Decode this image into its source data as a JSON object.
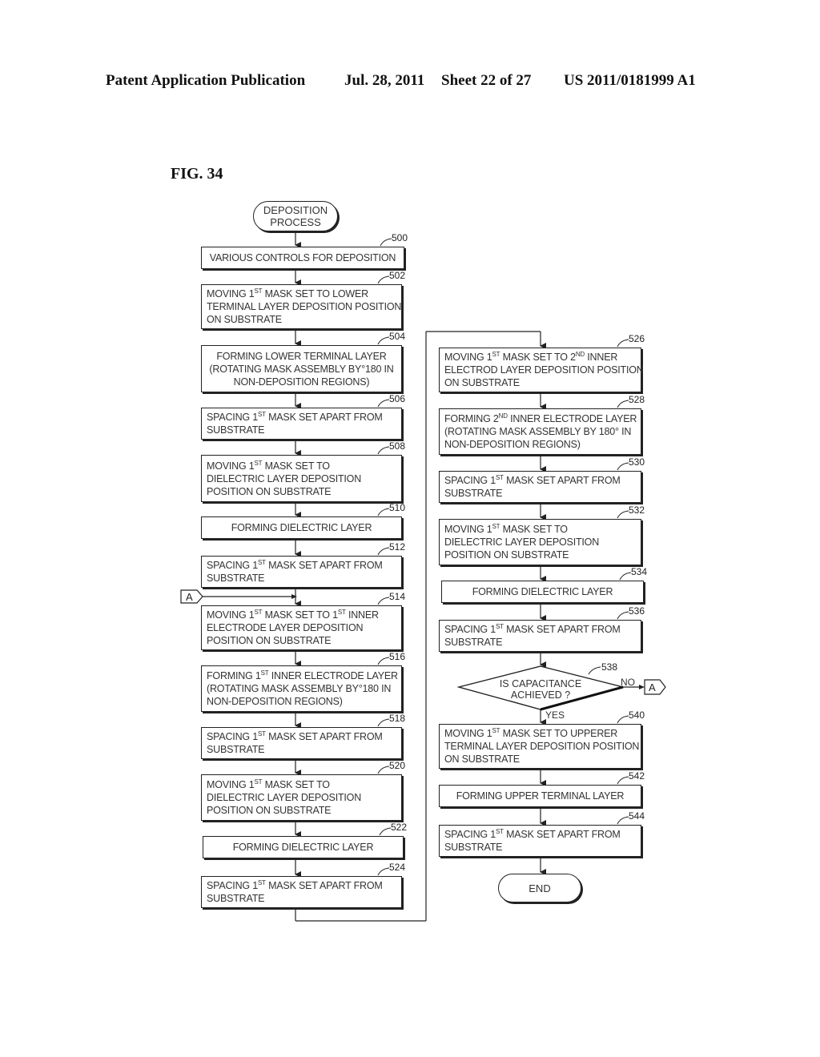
{
  "header": {
    "publication": "Patent Application Publication",
    "date": "Jul. 28, 2011",
    "sheet": "Sheet 22 of 27",
    "number": "US 2011/0181999 A1"
  },
  "figure": {
    "label": "FIG. 34",
    "start": {
      "line1": "DEPOSITION",
      "line2": "PROCESS"
    },
    "end": "END",
    "connector": "A",
    "decision": {
      "ref": "538",
      "line1": "IS CAPACITANCE",
      "line2": "ACHIEVED ?",
      "yes": "YES",
      "no": "NO"
    },
    "steps": [
      {
        "ref": "500",
        "lines": [
          "VARIOUS CONTROLS FOR DEPOSITION"
        ]
      },
      {
        "ref": "502",
        "lines": [
          "MOVING 1|ST| MASK SET TO LOWER",
          "TERMINAL LAYER DEPOSITION POSITION",
          "ON SUBSTRATE"
        ]
      },
      {
        "ref": "504",
        "lines": [
          "FORMING LOWER TERMINAL LAYER",
          "(ROTATING MASK ASSEMBLY BY°180  IN",
          "NON-DEPOSITION REGIONS)"
        ]
      },
      {
        "ref": "506",
        "lines": [
          "SPACING 1|ST| MASK SET APART FROM",
          "SUBSTRATE"
        ]
      },
      {
        "ref": "508",
        "lines": [
          "MOVING 1|ST| MASK SET TO",
          "DIELECTRIC LAYER DEPOSITION",
          "POSITION ON SUBSTRATE"
        ]
      },
      {
        "ref": "510",
        "lines": [
          "FORMING DIELECTRIC LAYER"
        ]
      },
      {
        "ref": "512",
        "lines": [
          "SPACING 1|ST| MASK SET APART FROM",
          "SUBSTRATE"
        ]
      },
      {
        "ref": "514",
        "lines": [
          "MOVING 1|ST| MASK SET TO 1|ST| INNER",
          "ELECTRODE LAYER DEPOSITION",
          "POSITION ON SUBSTRATE"
        ]
      },
      {
        "ref": "516",
        "lines": [
          "FORMING 1|ST| INNER ELECTRODE LAYER",
          "(ROTATING MASK ASSEMBLY BY°180  IN",
          "NON-DEPOSITION REGIONS)"
        ]
      },
      {
        "ref": "518",
        "lines": [
          "SPACING 1|ST| MASK SET APART FROM",
          "SUBSTRATE"
        ]
      },
      {
        "ref": "520",
        "lines": [
          "MOVING 1|ST| MASK SET TO",
          "DIELECTRIC LAYER DEPOSITION",
          "POSITION ON SUBSTRATE"
        ]
      },
      {
        "ref": "522",
        "lines": [
          "FORMING DIELECTRIC LAYER"
        ]
      },
      {
        "ref": "524",
        "lines": [
          "SPACING 1|ST| MASK SET APART FROM",
          "SUBSTRATE"
        ]
      },
      {
        "ref": "526",
        "lines": [
          "MOVING 1|ST| MASK SET TO 2|ND| INNER",
          "ELECTROD LAYER DEPOSITION POSITION",
          "ON SUBSTRATE"
        ]
      },
      {
        "ref": "528",
        "lines": [
          "FORMING 2|ND| INNER ELECTRODE LAYER",
          "(ROTATING MASK ASSEMBLY BY 180° IN",
          "NON-DEPOSITION REGIONS)"
        ]
      },
      {
        "ref": "530",
        "lines": [
          "SPACING 1|ST| MASK SET APART FROM",
          "SUBSTRATE"
        ]
      },
      {
        "ref": "532",
        "lines": [
          "MOVING 1|ST| MASK SET TO",
          "DIELECTRIC LAYER DEPOSITION",
          "POSITION ON SUBSTRATE"
        ]
      },
      {
        "ref": "534",
        "lines": [
          "FORMING DIELECTRIC LAYER"
        ]
      },
      {
        "ref": "536",
        "lines": [
          "SPACING 1|ST| MASK SET APART FROM",
          "SUBSTRATE"
        ]
      },
      {
        "ref": "540",
        "lines": [
          "MOVING 1|ST| MASK SET TO UPPERER",
          "TERMINAL LAYER DEPOSITION POSITION",
          "ON SUBSTRATE"
        ]
      },
      {
        "ref": "542",
        "lines": [
          "FORMING UPPER TERMINAL LAYER"
        ]
      },
      {
        "ref": "544",
        "lines": [
          "SPACING 1|ST| MASK SET APART FROM",
          "SUBSTRATE"
        ]
      }
    ]
  }
}
